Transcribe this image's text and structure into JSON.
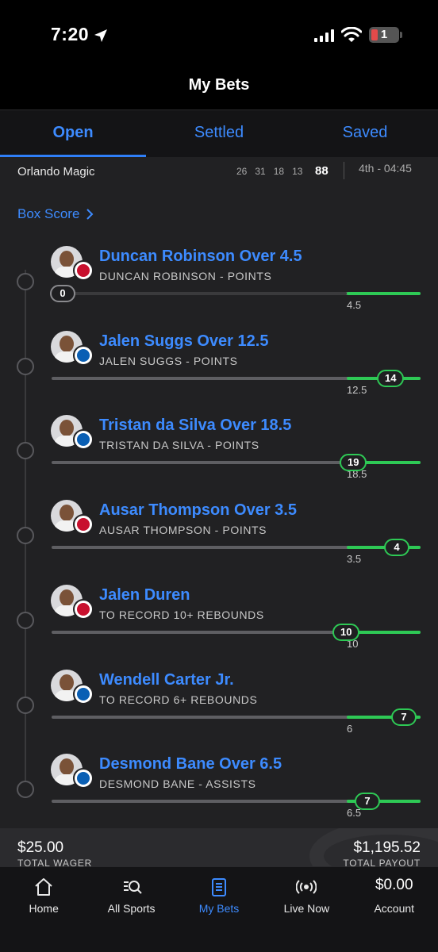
{
  "status_bar": {
    "time": "7:20",
    "battery_level": "1"
  },
  "header": {
    "title": "My Bets"
  },
  "tabs": [
    {
      "label": "Open",
      "active": true
    },
    {
      "label": "Settled",
      "active": false
    },
    {
      "label": "Saved",
      "active": false
    }
  ],
  "game": {
    "team": "Orlando Magic",
    "quarters": [
      "26",
      "31",
      "18",
      "13"
    ],
    "total": "88",
    "clock": "4th - 04:45"
  },
  "box_score_label": "Box Score",
  "legs": [
    {
      "title": "Duncan Robinson Over 4.5",
      "subtitle": "DUNCAN ROBINSON - POINTS",
      "team": "pistons",
      "current": "0",
      "line": "4.5",
      "progress": 0.0,
      "target": 0.8
    },
    {
      "title": "Jalen Suggs Over 12.5",
      "subtitle": "JALEN SUGGS - POINTS",
      "team": "magic",
      "current": "14",
      "line": "12.5",
      "progress": 0.92,
      "target": 0.8
    },
    {
      "title": "Tristan da Silva Over 18.5",
      "subtitle": "TRISTAN DA SILVA - POINTS",
      "team": "magic",
      "current": "19",
      "line": "18.5",
      "progress": 0.82,
      "target": 0.8
    },
    {
      "title": "Ausar Thompson Over 3.5",
      "subtitle": "AUSAR THOMPSON - POINTS",
      "team": "pistons",
      "current": "4",
      "line": "3.5",
      "progress": 0.94,
      "target": 0.8
    },
    {
      "title": "Jalen Duren",
      "subtitle": "TO RECORD 10+ REBOUNDS",
      "team": "pistons",
      "current": "10",
      "line": "10",
      "progress": 0.8,
      "target": 0.8
    },
    {
      "title": "Wendell Carter Jr.",
      "subtitle": "TO RECORD 6+ REBOUNDS",
      "team": "magic",
      "current": "7",
      "line": "6",
      "progress": 0.96,
      "target": 0.8
    },
    {
      "title": "Desmond Bane Over 6.5",
      "subtitle": "DESMOND BANE - ASSISTS",
      "team": "magic",
      "current": "7",
      "line": "6.5",
      "progress": 0.86,
      "target": 0.8
    }
  ],
  "summary": {
    "wager_amount": "$25.00",
    "wager_label": "TOTAL WAGER",
    "payout_amount": "$1,195.52",
    "payout_label": "TOTAL PAYOUT"
  },
  "nav": [
    {
      "label": "Home",
      "icon": "home-icon",
      "active": false
    },
    {
      "label": "All Sports",
      "icon": "all-sports-icon",
      "active": false
    },
    {
      "label": "My Bets",
      "icon": "my-bets-icon",
      "active": true
    },
    {
      "label": "Live Now",
      "icon": "live-now-icon",
      "active": false
    },
    {
      "label": "Account",
      "balance": "$0.00",
      "active": false
    }
  ],
  "colors": {
    "accent": "#3d8bff",
    "success": "#2ec955",
    "background": "#212123"
  }
}
